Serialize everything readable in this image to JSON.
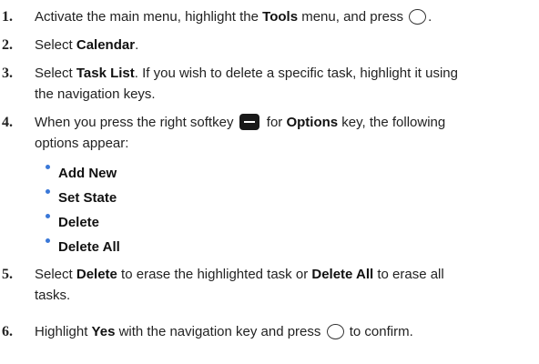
{
  "steps": [
    {
      "num": "1.",
      "t1": "Activate the main menu, highlight the ",
      "b1": "Tools",
      "t2": " menu, and press ",
      "t3": "."
    },
    {
      "num": "2.",
      "t1": "Select ",
      "b1": "Calendar",
      "t2": "."
    },
    {
      "num": "3.",
      "t1": "Select ",
      "b1": "Task List",
      "t2": ". If you wish to delete a specific task, highlight it using",
      "line2": "the navigation keys."
    },
    {
      "num": "4.",
      "t1": "When you press the right softkey ",
      "t2": " for ",
      "b1": "Options",
      "t3": " key, the following",
      "line2": "options appear:"
    },
    {
      "num": "5.",
      "t1": "Select ",
      "b1": "Delete",
      "t2": " to erase the highlighted task or ",
      "b2": "Delete All",
      "t3": " to erase all",
      "line2": "tasks."
    },
    {
      "num": "6.",
      "t1": "Highlight ",
      "b1": "Yes",
      "t2": " with the navigation key and press ",
      "t3": " to confirm."
    }
  ],
  "options": [
    "Add New",
    "Set State",
    "Delete",
    "Delete All"
  ],
  "icons": {
    "nav_key": "circle-key-icon",
    "softkey": "right-softkey-icon"
  },
  "colors": {
    "bullet": "#3a78d8",
    "text": "#222222"
  }
}
